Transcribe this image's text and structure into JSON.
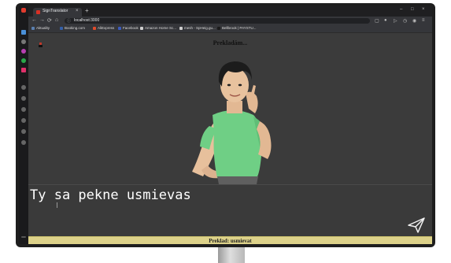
{
  "browser": {
    "tab": {
      "title": "SignTranslator",
      "close": "×"
    },
    "new_tab": "+",
    "window_controls": [
      "–",
      "□",
      "×"
    ],
    "nav_buttons": [
      "←",
      "→",
      "⟳",
      "⌂"
    ],
    "url": "localhost:3000",
    "bookmarks": [
      {
        "label": "Aktuality",
        "color": "#5a7fb0"
      },
      {
        "label": "Booking.com",
        "color": "#3560a8"
      },
      {
        "label": "AliExpress",
        "color": "#e04b2b"
      },
      {
        "label": "Facebook",
        "color": "#3b5bbd"
      },
      {
        "label": "Amazon Home Sc...",
        "color": "#cfcfcf"
      },
      {
        "label": "mesh - SpHeig.gu...",
        "color": "#cfcfcf"
      },
      {
        "label": "Bellbrook | PAYSTU...",
        "color": "#1b1b1b"
      }
    ]
  },
  "app": {
    "status_top": "Prekladám...",
    "input_text": "Ty sa pekne usmievas",
    "status_bottom": "Preklad: usmievat",
    "send_icon": "send-icon",
    "avatar_icon": "3d-sign-avatar"
  },
  "colors": {
    "app_bg": "#3b3b3b",
    "status_bar": "#ddd28a",
    "avatar_shirt": "#6fcf85",
    "text": "#ffffff"
  }
}
